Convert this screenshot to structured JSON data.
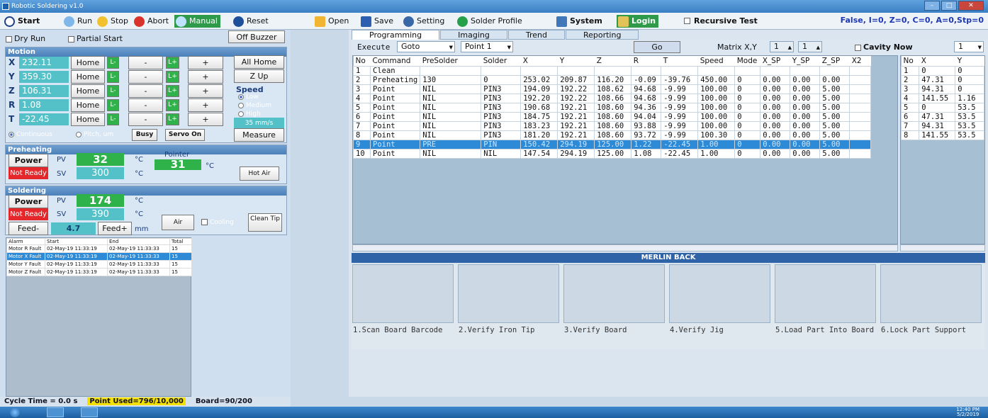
{
  "window": {
    "title": "Robotic Soldering v1.0"
  },
  "toolbar": {
    "start": "Start",
    "run": "Run",
    "stop": "Stop",
    "abort": "Abort",
    "manual": "Manual",
    "reset": "Reset",
    "open": "Open",
    "save": "Save",
    "setting": "Setting",
    "solder_profile": "Solder Profile",
    "system": "System",
    "login": "Login",
    "recursive_test": "Recursive Test",
    "status": "False, I=0, Z=0, C=0, A=0,Stp=0"
  },
  "left": {
    "dry_run": "Dry Run",
    "partial_start": "Partial Start",
    "off_buzzer": "Off Buzzer",
    "motion_title": "Motion",
    "axes": [
      {
        "label": "X",
        "value": "232.11"
      },
      {
        "label": "Y",
        "value": "359.30"
      },
      {
        "label": "Z",
        "value": "106.31"
      },
      {
        "label": "R",
        "value": "1.08"
      },
      {
        "label": "T",
        "value": "-22.45"
      }
    ],
    "home": "Home",
    "l_minus": "L-",
    "minus": "-",
    "l_plus": "L+",
    "plus": "+",
    "all_home": "All Home",
    "z_up": "Z Up",
    "speed_title": "Speed",
    "speed_low": "Low",
    "speed_medium": "Medium",
    "speed_high": "High",
    "speed_value": "35 mm/s",
    "continuous": "Continuous",
    "pitch": "Pitch, um",
    "busy": "Busy",
    "servo_on": "Servo On",
    "measure": "Measure",
    "preheat_title": "Preheating",
    "power": "Power",
    "pv": "PV",
    "sv": "SV",
    "deg": "°C",
    "preheat_pv": "32",
    "preheat_sv": "300",
    "not_ready": "Not Ready",
    "pointer": "Pointer",
    "pointer_value": "31",
    "hot_air": "Hot Air",
    "solder_title": "Soldering",
    "solder_pv": "174",
    "solder_sv": "390",
    "feed_minus": "Feed-",
    "feed_value": "4.7",
    "feed_plus": "Feed+",
    "mm": "mm",
    "air": "Air",
    "cooling": "Cooling",
    "clean_tip": "Clean Tip",
    "alarm_headers": [
      "Alarm",
      "Start",
      "End",
      "Total"
    ],
    "alarms": [
      [
        "Motor R Fault",
        "02-May-19 11:33:19",
        "02-May-19 11:33:33",
        "15"
      ],
      [
        "Motor X Fault",
        "02-May-19 11:33:19",
        "02-May-19 11:33:33",
        "15"
      ],
      [
        "Motor Y Fault",
        "02-May-19 11:33:19",
        "02-May-19 11:33:33",
        "15"
      ],
      [
        "Motor Z Fault",
        "02-May-19 11:33:19",
        "02-May-19 11:33:33",
        "15"
      ]
    ],
    "cycle_time": "Cycle Time = 0.0 s",
    "point_used": "Point Used=796/10,000",
    "board": "Board=90/200"
  },
  "tabs": [
    "Programming",
    "Imaging",
    "Trend",
    "Reporting"
  ],
  "controls": {
    "execute": "Execute",
    "goto": "Goto",
    "point": "Point 1",
    "go": "Go",
    "matrix": "Matrix X,Y",
    "mx": "1",
    "my": "1",
    "cavity_now": "Cavity Now",
    "cavity_value": "1"
  },
  "grid": {
    "headers": [
      "No",
      "Command",
      "PreSolder",
      "Solder",
      "X",
      "Y",
      "Z",
      "R",
      "T",
      "Speed",
      "Mode",
      "X_SP",
      "Y_SP",
      "Z_SP",
      "X2"
    ],
    "rows": [
      [
        "1",
        "Clean",
        "",
        "",
        "",
        "",
        "",
        "",
        "",
        "",
        "",
        "",
        "",
        "",
        ""
      ],
      [
        "2",
        "Preheating",
        "130",
        "0",
        "253.02",
        "209.87",
        "116.20",
        "-0.09",
        "-39.76",
        "450.00",
        "0",
        "0.00",
        "0.00",
        "0.00",
        ""
      ],
      [
        "3",
        "Point",
        "NIL",
        "PIN3",
        "194.09",
        "192.22",
        "108.62",
        "94.68",
        "-9.99",
        "100.00",
        "0",
        "0.00",
        "0.00",
        "5.00",
        ""
      ],
      [
        "4",
        "Point",
        "NIL",
        "PIN3",
        "192.20",
        "192.22",
        "108.66",
        "94.68",
        "-9.99",
        "100.00",
        "0",
        "0.00",
        "0.00",
        "5.00",
        ""
      ],
      [
        "5",
        "Point",
        "NIL",
        "PIN3",
        "190.68",
        "192.21",
        "108.60",
        "94.36",
        "-9.99",
        "100.00",
        "0",
        "0.00",
        "0.00",
        "5.00",
        ""
      ],
      [
        "6",
        "Point",
        "NIL",
        "PIN3",
        "184.75",
        "192.21",
        "108.60",
        "94.04",
        "-9.99",
        "100.00",
        "0",
        "0.00",
        "0.00",
        "5.00",
        ""
      ],
      [
        "7",
        "Point",
        "NIL",
        "PIN3",
        "183.23",
        "192.21",
        "108.60",
        "93.88",
        "-9.99",
        "100.00",
        "0",
        "0.00",
        "0.00",
        "5.00",
        ""
      ],
      [
        "8",
        "Point",
        "NIL",
        "PIN3",
        "181.20",
        "192.21",
        "108.60",
        "93.72",
        "-9.99",
        "100.30",
        "0",
        "0.00",
        "0.00",
        "5.00",
        ""
      ],
      [
        "9",
        "Point",
        "PRE",
        "PIN",
        "150.42",
        "294.19",
        "125.00",
        "1.22",
        "-22.45",
        "1.00",
        "0",
        "0.00",
        "0.00",
        "5.00",
        ""
      ],
      [
        "10",
        "Point",
        "NIL",
        "NIL",
        "147.54",
        "294.19",
        "125.00",
        "1.08",
        "-22.45",
        "1.00",
        "0",
        "0.00",
        "0.00",
        "5.00",
        ""
      ]
    ],
    "selected_row": 8
  },
  "grid2": {
    "headers": [
      "No",
      "X",
      "Y"
    ],
    "rows": [
      [
        "1",
        "0",
        "0"
      ],
      [
        "2",
        "47.31",
        "0"
      ],
      [
        "3",
        "94.31",
        "0"
      ],
      [
        "4",
        "141.55",
        "1.16"
      ],
      [
        "5",
        "0",
        "53.5"
      ],
      [
        "6",
        "47.31",
        "53.5"
      ],
      [
        "7",
        "94.31",
        "53.5"
      ],
      [
        "8",
        "141.55",
        "53.5"
      ]
    ]
  },
  "merlin": "MERLIN BACK",
  "steps": [
    "1.Scan Board Barcode",
    "2.Verify Iron Tip",
    "3.Verify Board",
    "4.Verify Jig",
    "5.Load Part Into Board",
    "6.Lock Part Support"
  ],
  "taskbar": {
    "time": "12:40 PM",
    "date": "5/2/2019"
  }
}
